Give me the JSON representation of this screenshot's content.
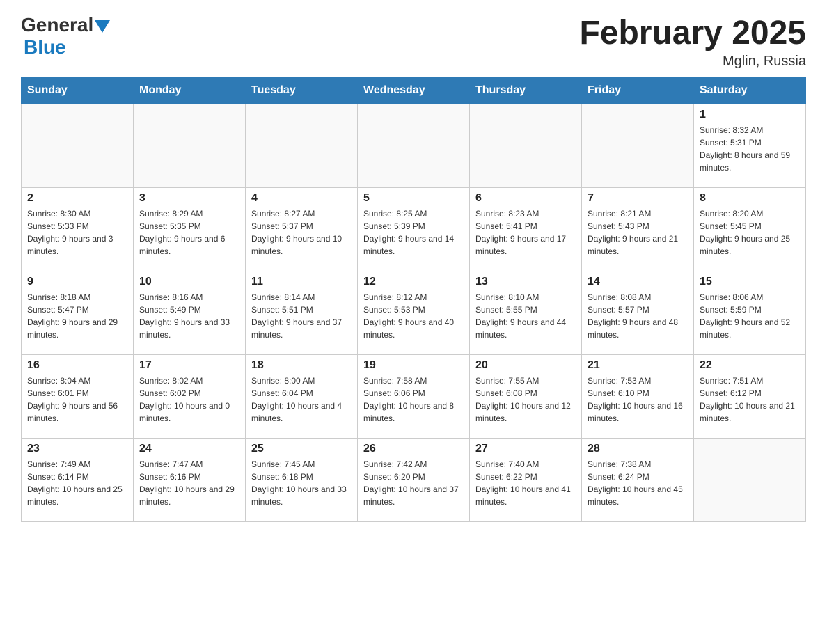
{
  "header": {
    "logo_general": "General",
    "logo_blue": "Blue",
    "month_title": "February 2025",
    "location": "Mglin, Russia"
  },
  "days_of_week": [
    "Sunday",
    "Monday",
    "Tuesday",
    "Wednesday",
    "Thursday",
    "Friday",
    "Saturday"
  ],
  "weeks": [
    [
      {
        "day": "",
        "info": ""
      },
      {
        "day": "",
        "info": ""
      },
      {
        "day": "",
        "info": ""
      },
      {
        "day": "",
        "info": ""
      },
      {
        "day": "",
        "info": ""
      },
      {
        "day": "",
        "info": ""
      },
      {
        "day": "1",
        "info": "Sunrise: 8:32 AM\nSunset: 5:31 PM\nDaylight: 8 hours and 59 minutes."
      }
    ],
    [
      {
        "day": "2",
        "info": "Sunrise: 8:30 AM\nSunset: 5:33 PM\nDaylight: 9 hours and 3 minutes."
      },
      {
        "day": "3",
        "info": "Sunrise: 8:29 AM\nSunset: 5:35 PM\nDaylight: 9 hours and 6 minutes."
      },
      {
        "day": "4",
        "info": "Sunrise: 8:27 AM\nSunset: 5:37 PM\nDaylight: 9 hours and 10 minutes."
      },
      {
        "day": "5",
        "info": "Sunrise: 8:25 AM\nSunset: 5:39 PM\nDaylight: 9 hours and 14 minutes."
      },
      {
        "day": "6",
        "info": "Sunrise: 8:23 AM\nSunset: 5:41 PM\nDaylight: 9 hours and 17 minutes."
      },
      {
        "day": "7",
        "info": "Sunrise: 8:21 AM\nSunset: 5:43 PM\nDaylight: 9 hours and 21 minutes."
      },
      {
        "day": "8",
        "info": "Sunrise: 8:20 AM\nSunset: 5:45 PM\nDaylight: 9 hours and 25 minutes."
      }
    ],
    [
      {
        "day": "9",
        "info": "Sunrise: 8:18 AM\nSunset: 5:47 PM\nDaylight: 9 hours and 29 minutes."
      },
      {
        "day": "10",
        "info": "Sunrise: 8:16 AM\nSunset: 5:49 PM\nDaylight: 9 hours and 33 minutes."
      },
      {
        "day": "11",
        "info": "Sunrise: 8:14 AM\nSunset: 5:51 PM\nDaylight: 9 hours and 37 minutes."
      },
      {
        "day": "12",
        "info": "Sunrise: 8:12 AM\nSunset: 5:53 PM\nDaylight: 9 hours and 40 minutes."
      },
      {
        "day": "13",
        "info": "Sunrise: 8:10 AM\nSunset: 5:55 PM\nDaylight: 9 hours and 44 minutes."
      },
      {
        "day": "14",
        "info": "Sunrise: 8:08 AM\nSunset: 5:57 PM\nDaylight: 9 hours and 48 minutes."
      },
      {
        "day": "15",
        "info": "Sunrise: 8:06 AM\nSunset: 5:59 PM\nDaylight: 9 hours and 52 minutes."
      }
    ],
    [
      {
        "day": "16",
        "info": "Sunrise: 8:04 AM\nSunset: 6:01 PM\nDaylight: 9 hours and 56 minutes."
      },
      {
        "day": "17",
        "info": "Sunrise: 8:02 AM\nSunset: 6:02 PM\nDaylight: 10 hours and 0 minutes."
      },
      {
        "day": "18",
        "info": "Sunrise: 8:00 AM\nSunset: 6:04 PM\nDaylight: 10 hours and 4 minutes."
      },
      {
        "day": "19",
        "info": "Sunrise: 7:58 AM\nSunset: 6:06 PM\nDaylight: 10 hours and 8 minutes."
      },
      {
        "day": "20",
        "info": "Sunrise: 7:55 AM\nSunset: 6:08 PM\nDaylight: 10 hours and 12 minutes."
      },
      {
        "day": "21",
        "info": "Sunrise: 7:53 AM\nSunset: 6:10 PM\nDaylight: 10 hours and 16 minutes."
      },
      {
        "day": "22",
        "info": "Sunrise: 7:51 AM\nSunset: 6:12 PM\nDaylight: 10 hours and 21 minutes."
      }
    ],
    [
      {
        "day": "23",
        "info": "Sunrise: 7:49 AM\nSunset: 6:14 PM\nDaylight: 10 hours and 25 minutes."
      },
      {
        "day": "24",
        "info": "Sunrise: 7:47 AM\nSunset: 6:16 PM\nDaylight: 10 hours and 29 minutes."
      },
      {
        "day": "25",
        "info": "Sunrise: 7:45 AM\nSunset: 6:18 PM\nDaylight: 10 hours and 33 minutes."
      },
      {
        "day": "26",
        "info": "Sunrise: 7:42 AM\nSunset: 6:20 PM\nDaylight: 10 hours and 37 minutes."
      },
      {
        "day": "27",
        "info": "Sunrise: 7:40 AM\nSunset: 6:22 PM\nDaylight: 10 hours and 41 minutes."
      },
      {
        "day": "28",
        "info": "Sunrise: 7:38 AM\nSunset: 6:24 PM\nDaylight: 10 hours and 45 minutes."
      },
      {
        "day": "",
        "info": ""
      }
    ]
  ]
}
